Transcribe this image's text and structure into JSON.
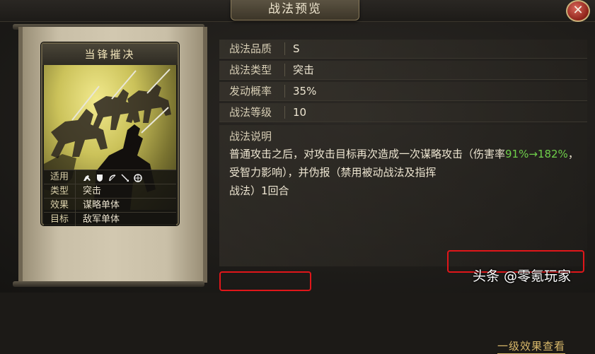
{
  "window": {
    "title": "战法预览",
    "close_icon": "close-icon"
  },
  "card": {
    "name": "当锋摧决",
    "rows": [
      {
        "label": "适用",
        "value": ""
      },
      {
        "label": "类型",
        "value": "突击"
      },
      {
        "label": "效果",
        "value": "谋略单体"
      },
      {
        "label": "目标",
        "value": "敌军单体"
      }
    ],
    "troop_icons": [
      "cavalry-icon",
      "shield-icon",
      "bow-icon",
      "spear-icon",
      "wheel-icon"
    ]
  },
  "details": {
    "quality_label": "战法品质",
    "quality_value": "S",
    "type_label": "战法类型",
    "type_value": "突击",
    "rate_label": "发动概率",
    "rate_value": "35%",
    "level_label": "战法等级",
    "level_value": "10",
    "desc_label": "战法说明",
    "desc_part1": "普通攻击之后，对攻击目标再次造成一次谋略攻击（伤害率",
    "desc_green": "91%→182%",
    "desc_part2": "，受智力影响），并伪报（",
    "desc_highlight1": "禁用被动战法及指挥",
    "desc_highlight2": "战法）1回合",
    "level_effects_link": "一级效果查看"
  },
  "watermark": "头条 @零氪玩家",
  "colors": {
    "highlight_box": "#e0161a",
    "green_text": "#6fcf4a",
    "link": "#d8b86a"
  }
}
